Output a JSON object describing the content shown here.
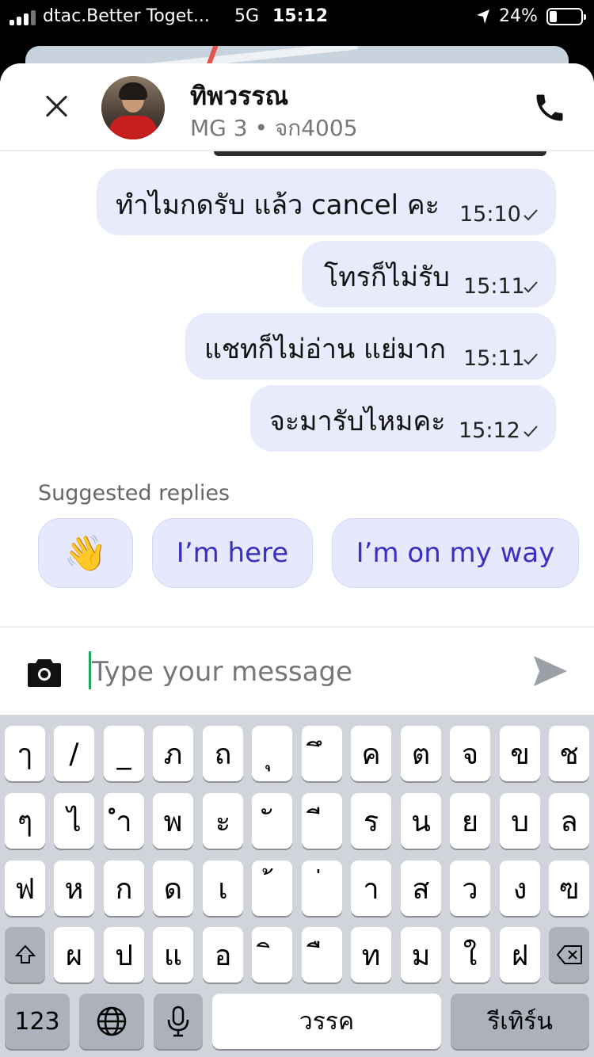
{
  "status_bar": {
    "carrier": "dtac.Better Toget...",
    "network": "5G",
    "time": "15:12",
    "battery_percent": "24%",
    "battery_level": 0.24
  },
  "header": {
    "close_icon": "close-icon",
    "contact_name": "ทิพวรรณ",
    "vehicle_info": "MG 3 • จก4005",
    "call_icon": "phone-icon"
  },
  "messages": [
    {
      "text": "ทำไมกดรับ แล้ว cancel คะ",
      "time": "15:10",
      "status_icon": "check-icon"
    },
    {
      "text": "โทรก็ไม่รับ",
      "time": "15:11",
      "status_icon": "check-icon"
    },
    {
      "text": "แชทก็ไม่อ่าน แย่มาก",
      "time": "15:11",
      "status_icon": "check-icon"
    },
    {
      "text": "จะมารับไหมคะ",
      "time": "15:12",
      "status_icon": "check-icon"
    }
  ],
  "suggested": {
    "label": "Suggested replies",
    "replies": [
      "👋",
      "I’m here",
      "I’m on my way"
    ]
  },
  "composer": {
    "camera_icon": "camera-icon",
    "placeholder": "Type your message",
    "value": "",
    "send_icon": "send-icon"
  },
  "keyboard": {
    "row1": [
      "ๅ",
      "/",
      "_",
      "ภ",
      "ถ",
      "ุ",
      "ึ",
      "ค",
      "ต",
      "จ",
      "ข",
      "ช"
    ],
    "row2": [
      "ๆ",
      "ไ",
      "ำ",
      "พ",
      "ะ",
      "ั",
      "ี",
      "ร",
      "น",
      "ย",
      "บ",
      "ล"
    ],
    "row3": [
      "ฟ",
      "ห",
      "ก",
      "ด",
      "เ",
      "้",
      "่",
      "า",
      "ส",
      "ว",
      "ง",
      "ฃ"
    ],
    "row4": [
      "ผ",
      "ป",
      "แ",
      "อ",
      "ิ",
      "ื",
      "ท",
      "ม",
      "ใ",
      "ฝ"
    ],
    "shift_icon": "shift-icon",
    "delete_icon": "delete-icon",
    "numbers": "123",
    "globe_icon": "globe-icon",
    "mic_icon": "microphone-icon",
    "space": "วรรค",
    "return": "รีเทิร์น"
  },
  "colors": {
    "bubble": "#e8ebfb",
    "chip_text": "#3a2fc1",
    "cursor": "#22a35a"
  }
}
